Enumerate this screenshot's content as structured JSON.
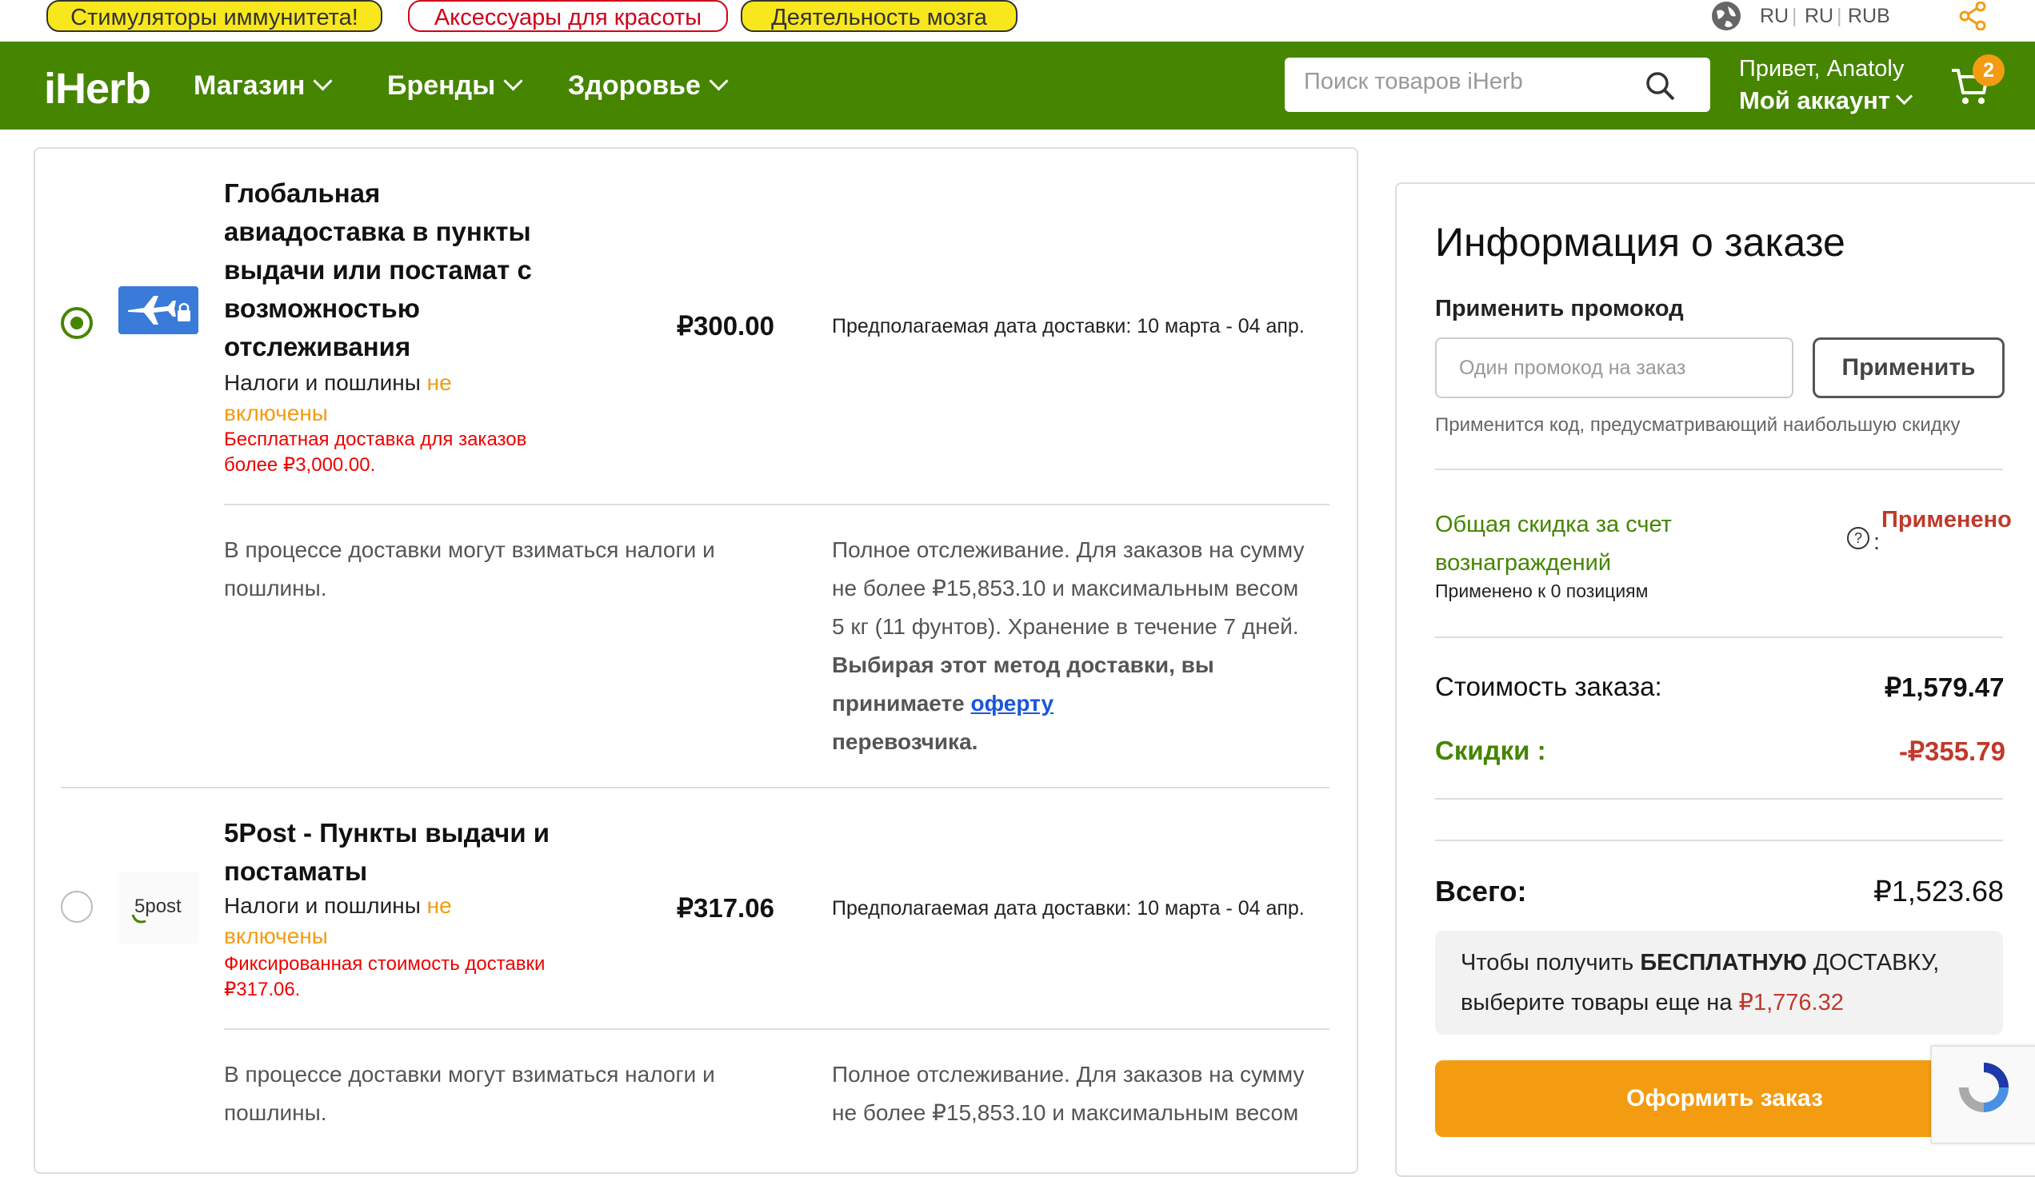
{
  "topbar": {
    "pills": [
      "Стимуляторы иммунитета!",
      "Аксессуары для красоты",
      "Деятельность мозга"
    ],
    "lang1": "RU",
    "sep": "|",
    "lang2": "RU",
    "currency": "RUB",
    "icons": [
      "globe-icon",
      "share-icon"
    ]
  },
  "header": {
    "logo": "iHerb",
    "nav": [
      "Магазин",
      "Бренды",
      "Здоровье"
    ],
    "search_placeholder": "Поиск товаров iHerb",
    "greeting": "Привет, Anatoly",
    "account": "Мой аккаунт",
    "cart_count": "2",
    "colors": {
      "brand_green": "#458500",
      "accent_orange": "#f39c12"
    }
  },
  "shipping": {
    "options": [
      {
        "selected": true,
        "title_lines": [
          "Глобальная",
          "авиадоставка в пункты",
          "выдачи или постамат с",
          "возможностью",
          "отслеживания"
        ],
        "tax_prefix": "Налоги и пошлины",
        "tax_not": "не",
        "tax_suffix": "включены",
        "note_lines": [
          "Бесплатная доставка для заказов",
          "более ₽3,000.00."
        ],
        "price": "₽300.00",
        "date": "Предполагаемая дата доставки: 10 марта - 04 апр.",
        "detail_left": [
          "В процессе доставки могут взиматься налоги и",
          "пошлины."
        ],
        "detail_right": [
          "Полное отслеживание. Для заказов на сумму",
          "не более ₽15,853.10 и максимальным весом",
          "5 кг (11 фунтов). Хранение в течение 7 дней."
        ],
        "offer_bold_1": "Выбирая этот метод доставки, вы",
        "offer_bold_2": "принимаете",
        "offer_link": "оферту",
        "offer_bold_3": "перевозчика."
      },
      {
        "selected": false,
        "logo_text": "5post",
        "title_lines": [
          "5Post - Пункты выдачи и",
          "постаматы"
        ],
        "tax_prefix": "Налоги и пошлины",
        "tax_not": "не",
        "tax_suffix": "включены",
        "note_lines": [
          "Фиксированная стоимость доставки",
          "₽317.06."
        ],
        "price": "₽317.06",
        "date": "Предполагаемая дата доставки: 10 марта - 04 апр.",
        "detail_left": [
          "В процессе доставки могут взиматься налоги и",
          "пошлины."
        ],
        "detail_right": [
          "Полное отслеживание. Для заказов на сумму",
          "не более ₽15,853.10 и максимальным весом"
        ]
      }
    ]
  },
  "summary": {
    "title": "Информация о заказе",
    "promo_label": "Применить промокод",
    "promo_placeholder": "Один промокод на заказ",
    "apply": "Применить",
    "promo_hint": "Применится код, предусматривающий наибольшую скидку",
    "reward_line1": "Общая скидка за счет",
    "reward_line2": "вознаграждений",
    "reward_applied": "Применено",
    "reward_colon": ":",
    "reward_positions": "Применено к 0 позициям",
    "subtotal_label": "Стоимость заказа:",
    "subtotal_value": "₽1,579.47",
    "discount_label": "Скидки",
    "discount_colon": ":",
    "discount_value": "-₽355.79",
    "total_label": "Всего:",
    "total_value": "₽1,523.68",
    "free_line1_a": "Чтобы получить",
    "free_line1_b": "БЕСПЛАТНУЮ",
    "free_line1_c": "ДОСТАВКУ,",
    "free_line2_a": "выберите товары еще на",
    "free_line2_b": "₽1,776.32",
    "checkout": "Оформить заказ"
  }
}
